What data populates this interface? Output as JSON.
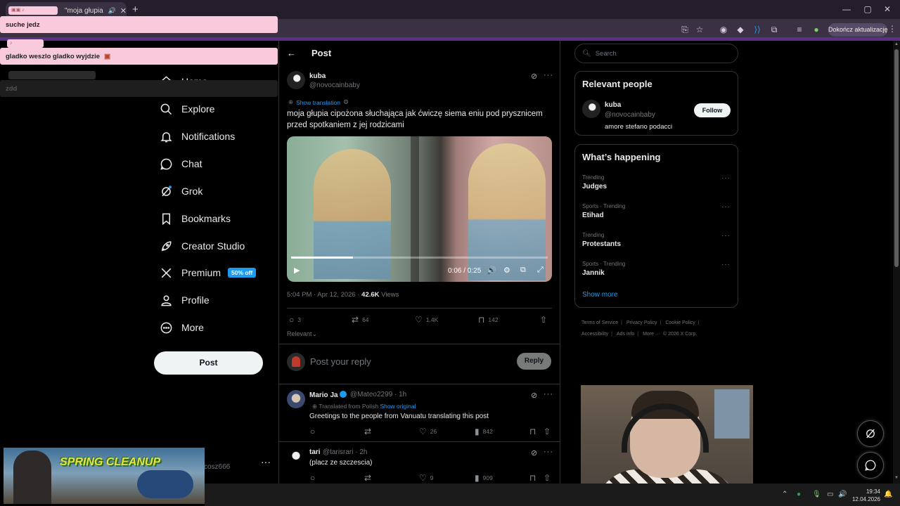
{
  "browser": {
    "tab_title": "\"moja głupia cip",
    "new_tab": "+",
    "update_button": "Dokończ aktualizację",
    "tab_audio_icon": "speaker-icon",
    "window_controls": [
      "—",
      "▢",
      "✕"
    ]
  },
  "nav": {
    "items": [
      {
        "label": "Home",
        "icon": "home-icon"
      },
      {
        "label": "Explore",
        "icon": "search-icon"
      },
      {
        "label": "Notifications",
        "icon": "bell-icon"
      },
      {
        "label": "Chat",
        "icon": "chat-icon"
      },
      {
        "label": "Grok",
        "icon": "grok-icon"
      },
      {
        "label": "Bookmarks",
        "icon": "bookmark-icon"
      },
      {
        "label": "Creator Studio",
        "icon": "rocket-icon"
      },
      {
        "label": "Premium",
        "icon": "x-logo-icon",
        "badge": "50% off"
      },
      {
        "label": "Profile",
        "icon": "person-icon"
      },
      {
        "label": "More",
        "icon": "more-circle-icon"
      }
    ],
    "post_button": "Post",
    "username_fragment": "cosz666"
  },
  "post": {
    "header_title": "Post",
    "author_name": "kuba",
    "author_handle": "@novocainbaby",
    "show_translation": "Show translation",
    "text": "moja głupia cipożona słuchająca jak ćwiczę siema eniu pod prysznicem przed spotkaniem z jej rodzicami",
    "video": {
      "time": "0:06 / 0:25",
      "progress": 0.24
    },
    "timestamp": "5:04 PM · Apr 12, 2026 · ",
    "views_count": "42.6K",
    "views_label": " Views",
    "stats": {
      "replies": "3",
      "reposts": "64",
      "likes": "1.4K",
      "bookmarks": "142"
    },
    "sort_label": "Relevant",
    "reply_placeholder": "Post your reply",
    "reply_button": "Reply"
  },
  "comments": [
    {
      "name": "Mario Ja",
      "meta": "@Mateo2299 · 1h",
      "translated_label": "Translated from Polish",
      "show_original": "Show original",
      "text": "Greetings to the people from Vanuatu translating this post",
      "likes": "26",
      "views": "842"
    },
    {
      "name": "tari",
      "meta": "@tarisrari · 2h",
      "text": "(placz ze szczescia)",
      "likes": "9",
      "views": "909"
    }
  ],
  "sidebar": {
    "search_placeholder": "Search",
    "relevant_title": "Relevant people",
    "relevant_person": {
      "name": "kuba",
      "handle": "@novocainbaby",
      "bio": "amore stefano podacci",
      "follow": "Follow"
    },
    "happening_title": "What’s happening",
    "trends": [
      {
        "label": "Trending",
        "name": "Judges"
      },
      {
        "label": "Sports · Trending",
        "name": "Etihad"
      },
      {
        "label": "Trending",
        "name": "Protestants"
      },
      {
        "label": "Sports · Trending",
        "name": "Jannik"
      }
    ],
    "show_more": "Show more",
    "footer": [
      "Terms of Service",
      "Privacy Policy",
      "Cookie Policy",
      "Accessibility",
      "Ads info",
      "More ···",
      "© 2026 X Corp."
    ]
  },
  "chat_overlay": {
    "messages": [
      "suche jedz",
      "gladko weszlo gladko wyjdzie",
      "zdd"
    ]
  },
  "stream": {
    "game_title": "SPRING CLEANUP"
  },
  "taskbar": {
    "time": "19:34",
    "date": "12.04.2026"
  },
  "colors": {
    "accent": "#1d9bf0",
    "background": "#000000",
    "chat_pink": "#f9c9dc",
    "browser_rail": "#5c2f86"
  }
}
